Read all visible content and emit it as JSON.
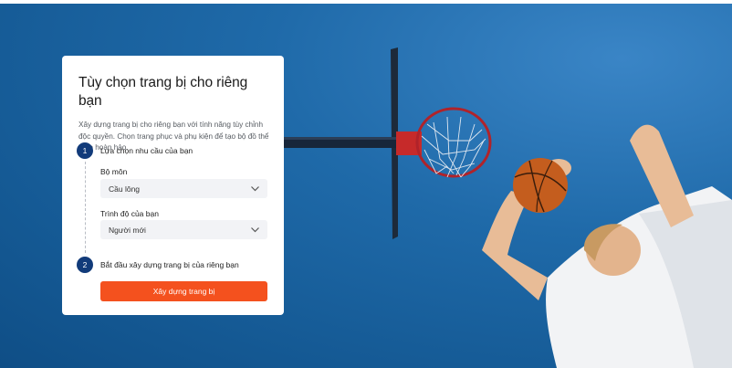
{
  "card": {
    "title": "Tùy chọn trang bị cho riêng bạn",
    "description": "Xây dựng trang bị cho riêng bạn với tính năng tùy chỉnh độc quyền. Chọn trang phục và phụ kiện để tạo bộ đồ thể thao hoàn hảo."
  },
  "steps": [
    {
      "number": "1",
      "label": "Lựa chọn nhu cầu của bạn"
    },
    {
      "number": "2",
      "label": "Bắt đầu xây dựng trang bị của riêng bạn"
    }
  ],
  "fields": {
    "sport": {
      "label": "Bộ môn",
      "value": "Cầu lông"
    },
    "level": {
      "label": "Trình độ của bạn",
      "value": "Người mới"
    }
  },
  "cta": {
    "label": "Xây dựng trang bị"
  },
  "colors": {
    "sky": "#1f6aa9",
    "step_badge": "#123b7a",
    "cta": "#f4511e",
    "select_bg": "#f2f3f6"
  },
  "icons": {
    "select_arrow": "chevron-down-icon"
  }
}
